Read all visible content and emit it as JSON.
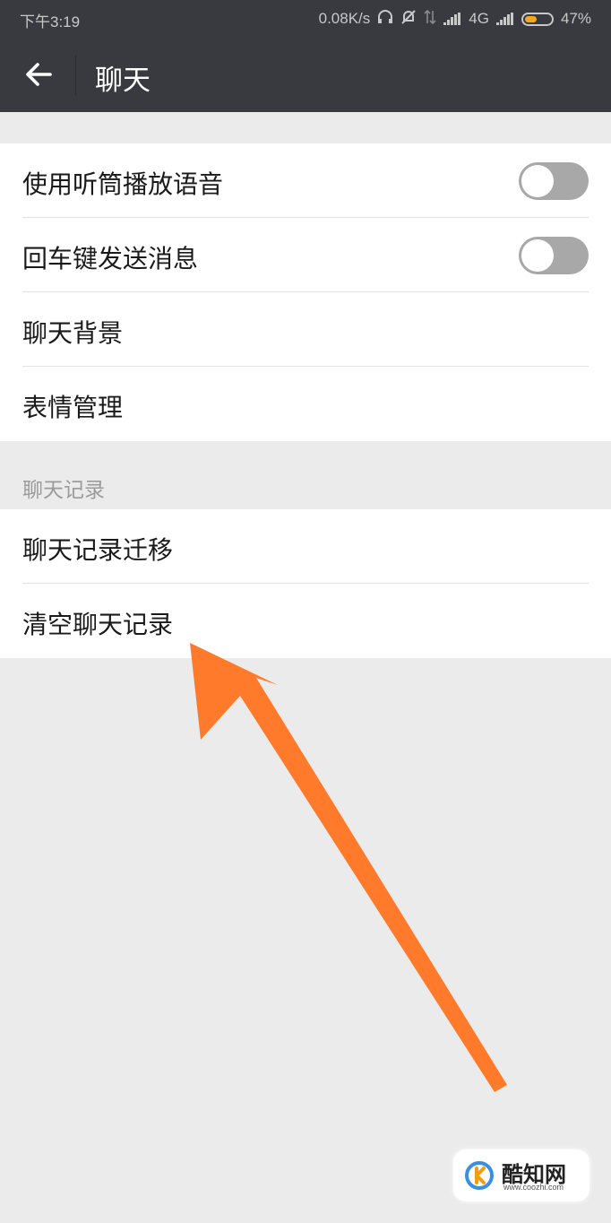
{
  "status_bar": {
    "time": "下午3:19",
    "speed": "0.08K/s",
    "network": "4G",
    "battery": "47%",
    "battery_level": 0.47,
    "icons": [
      "headset-icon",
      "mute-bell-icon",
      "data-arrows-icon",
      "signal-icon",
      "signal-icon"
    ]
  },
  "header": {
    "title": "聊天",
    "back_icon": "arrow-left-icon",
    "bg_color": "#393a3f"
  },
  "settings": {
    "items": [
      {
        "label": "使用听筒播放语音",
        "toggle": false
      },
      {
        "label": "回车键发送消息",
        "toggle": false
      },
      {
        "label": "聊天背景"
      },
      {
        "label": "表情管理"
      }
    ]
  },
  "chat_history": {
    "section_title": "聊天记录",
    "items": [
      {
        "label": "聊天记录迁移"
      },
      {
        "label": "清空聊天记录"
      }
    ]
  },
  "annotation": {
    "arrow_color": "#ff7a2a"
  },
  "watermark": {
    "brand": "酷知网",
    "url": "www.coozhi.com"
  }
}
